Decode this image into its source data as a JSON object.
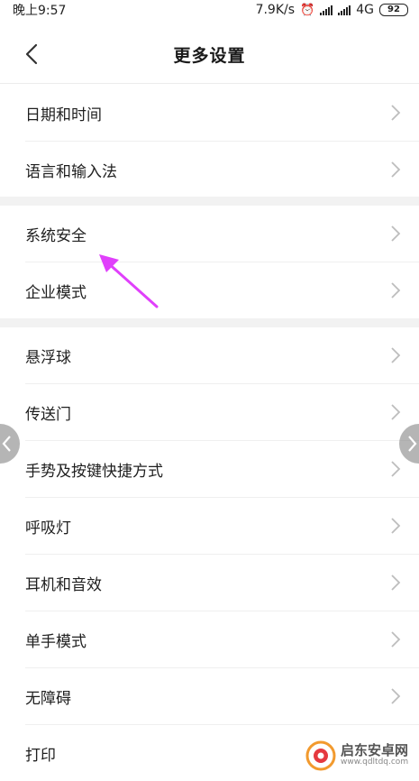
{
  "status_bar": {
    "time": "晚上9:57",
    "net_speed": "7.9K/s",
    "network": "4G",
    "network_suffix": "ll",
    "battery": "92",
    "icons": [
      "alarm-icon",
      "signal-icon",
      "signal-icon",
      "battery-icon"
    ]
  },
  "header": {
    "title": "更多设置",
    "back_icon": "chevron-left-icon"
  },
  "groups": [
    {
      "items": [
        {
          "label": "日期和时间"
        },
        {
          "label": "语言和输入法"
        }
      ]
    },
    {
      "items": [
        {
          "label": "系统安全"
        },
        {
          "label": "企业模式"
        }
      ]
    },
    {
      "items": [
        {
          "label": "悬浮球"
        },
        {
          "label": "传送门"
        },
        {
          "label": "手势及按键快捷方式"
        },
        {
          "label": "呼吸灯"
        },
        {
          "label": "耳机和音效"
        },
        {
          "label": "单手模式"
        },
        {
          "label": "无障碍"
        },
        {
          "label": "打印"
        }
      ]
    }
  ],
  "annotation": {
    "arrow_color": "#e040fb"
  },
  "watermark": {
    "title": "启东安卓网",
    "url": "www.qdltdq.com"
  },
  "colors": {
    "background": "#ffffff",
    "section_gap": "#f2f2f2",
    "chevron": "#bdbdbd"
  }
}
